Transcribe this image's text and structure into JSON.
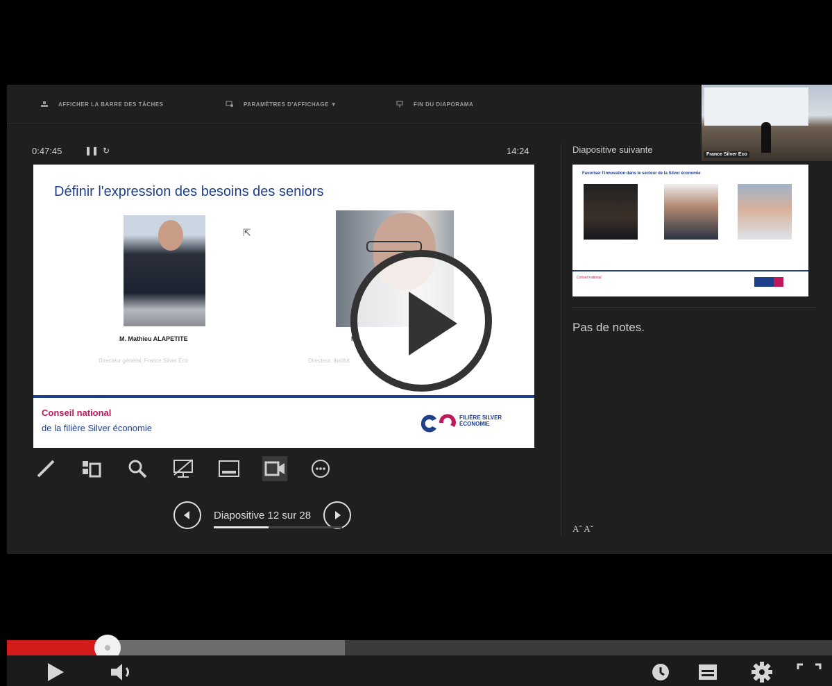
{
  "presenter": {
    "toolbar": {
      "taskbar": "AFFICHER LA BARRE DES TÂCHES",
      "display_settings": "PARAMÈTRES D'AFFICHAGE ▼",
      "end_show": "FIN DU DIAPORAMA"
    },
    "timer": "0:47:45",
    "clock": "14:24",
    "current_slide": {
      "title": "Définir l'expression des besoins des seniors",
      "person1_name": "M. Mathieu ALAPETITE",
      "person1_role": "Directeur général, France Silver Éco",
      "person2_name": "M",
      "person2_role": "Directeur, Institut",
      "footer_line1": "Conseil national",
      "footer_line2": "de la filière Silver économie",
      "logo_line1": "FILIÈRE SILVER",
      "logo_line2": "ÉCONOMIE"
    },
    "navigation": {
      "label": "Diapositive 12 sur 28",
      "current": 12,
      "total": 28
    },
    "next_slide": {
      "heading": "Diapositive suivante",
      "title": "Favoriser l'innovation dans le secteur de la Silver économie"
    },
    "notes": "Pas de notes.",
    "font_controls": "Aˆ  Aˇ",
    "camera": {
      "tag": "France Silver Eco"
    }
  },
  "player": {
    "played_fraction": 0.122,
    "buffered_fraction": 0.41,
    "icons": [
      "play-icon",
      "volume-icon",
      "clock-icon",
      "subtitles-icon",
      "settings-icon",
      "fullscreen-icon"
    ]
  },
  "colors": {
    "accent_blue": "#1e3f8a",
    "accent_pink": "#c0185b",
    "progress_red": "#d31b1b"
  }
}
